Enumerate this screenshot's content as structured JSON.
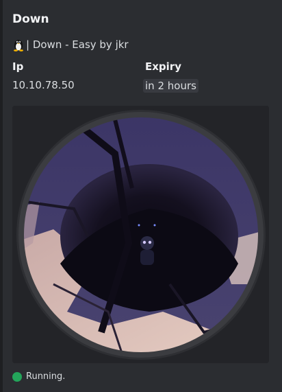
{
  "embed": {
    "title": "Down",
    "description": "| Down - Easy by jkr",
    "os_icon": "linux-tux-icon",
    "fields": {
      "ip": {
        "name": "Ip",
        "value": "10.10.78.50"
      },
      "expiry": {
        "name": "Expiry",
        "value": "in 2 hours"
      }
    },
    "thumbnail_icon": "down-machine-artwork",
    "status": {
      "text": "Running.",
      "color": "#23a55a"
    }
  },
  "colors": {
    "background": "#2b2d31",
    "code_background": "#383a40",
    "accent_border": "#1e1f22"
  }
}
